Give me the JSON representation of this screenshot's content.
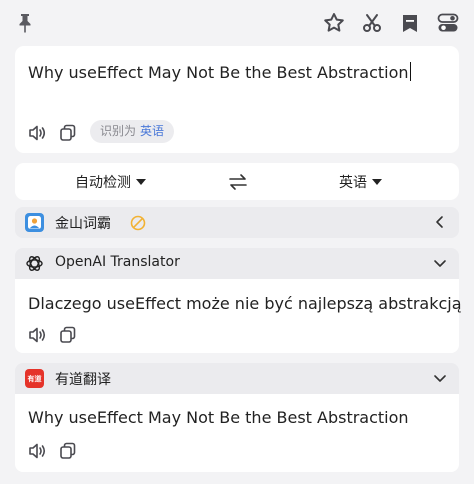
{
  "toolbar": {
    "icons": [
      "pin-icon",
      "star-icon",
      "scissors-icon",
      "bookmark-icon",
      "settings-toggle-icon"
    ]
  },
  "source": {
    "text": "Why useEffect May Not Be the Best Abstraction",
    "detected_prefix": "识别为",
    "detected_lang": "英语"
  },
  "lang_bar": {
    "source_lang": "自动检测",
    "target_lang": "英语"
  },
  "engines": [
    {
      "name": "金山词霸",
      "collapsed": true,
      "status": "disabled"
    },
    {
      "name": "OpenAI Translator",
      "result": "Dlaczego useEffect może nie być najlepszą abstrakcją"
    },
    {
      "name": "有道翻译",
      "logo_text": "有道",
      "result": "Why useEffect May Not Be the Best Abstraction"
    }
  ],
  "colors": {
    "accent": "#4a78d8",
    "youdao_red": "#e5332a",
    "disabled_orange": "#f2b233"
  }
}
